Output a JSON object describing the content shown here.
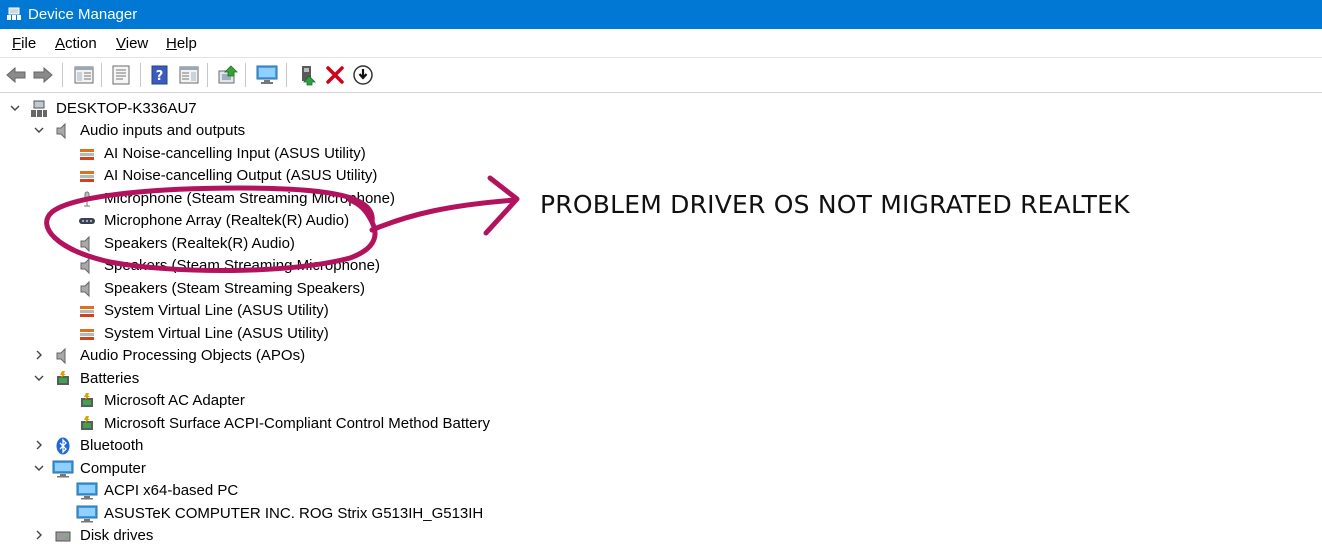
{
  "window": {
    "title": "Device Manager"
  },
  "menu": {
    "file_key": "F",
    "file_rest": "ile",
    "action_key": "A",
    "action_rest": "ction",
    "view_key": "V",
    "view_rest": "iew",
    "help_key": "H",
    "help_rest": "elp"
  },
  "toolbar": {
    "icons": [
      "back-arrow-icon",
      "forward-arrow-icon",
      "show-hide-console-tree-icon",
      "properties-icon",
      "help-icon",
      "action-pane-icon",
      "update-driver-software-icon",
      "scan-hardware-icon",
      "enable-device-icon",
      "uninstall-device-icon",
      "disable-device-icon"
    ]
  },
  "tree": {
    "root": "DESKTOP-K336AU7",
    "audio_io": {
      "label": "Audio inputs and outputs",
      "items": [
        "AI Noise-cancelling Input (ASUS Utility)",
        "AI Noise-cancelling Output (ASUS Utility)",
        "Microphone (Steam Streaming Microphone)",
        "Microphone Array (Realtek(R) Audio)",
        "Speakers (Realtek(R) Audio)",
        "Speakers (Steam Streaming Microphone)",
        "Speakers (Steam Streaming Speakers)",
        "System Virtual Line (ASUS Utility)",
        "System Virtual Line (ASUS Utility)"
      ]
    },
    "apo": {
      "label": "Audio Processing Objects (APOs)"
    },
    "batteries": {
      "label": "Batteries",
      "items": [
        "Microsoft AC Adapter",
        "Microsoft Surface ACPI-Compliant Control Method Battery"
      ]
    },
    "bluetooth": {
      "label": "Bluetooth"
    },
    "computer": {
      "label": "Computer",
      "items": [
        "ACPI x64-based PC",
        "ASUSTeK COMPUTER INC. ROG Strix G513IH_G513IH"
      ]
    },
    "disk": {
      "label": "Disk drives"
    }
  },
  "annotation": {
    "text": "PROBLEM DRIVER OS NOT MIGRATED REALTEK",
    "color": "#b3135c"
  },
  "colors": {
    "titlebar": "#0078d4"
  }
}
